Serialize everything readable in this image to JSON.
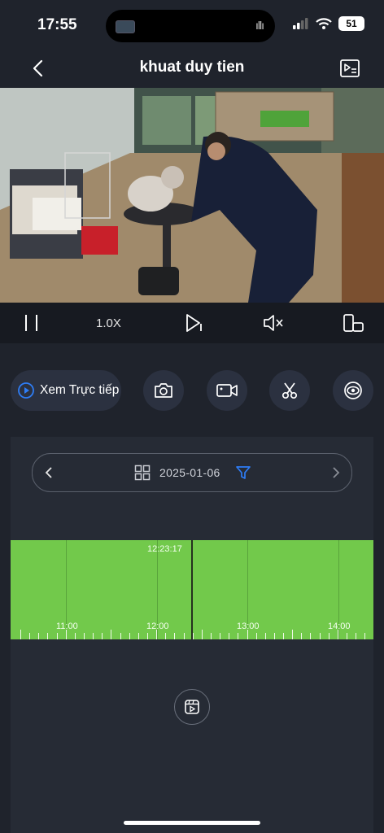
{
  "status": {
    "time": "17:55",
    "battery": "51"
  },
  "header": {
    "title": "khuat duy tien"
  },
  "player": {
    "speed": "1.0X"
  },
  "actions": {
    "live_label": "Xem Trực tiếp"
  },
  "playback": {
    "date": "2025-01-06",
    "cursor_time": "12:23:17",
    "hours": [
      "11:00",
      "12:00",
      "13:00",
      "14:00"
    ]
  },
  "colors": {
    "timeline": "#72c94b",
    "accent": "#2e7df6",
    "background": "#1f232c"
  },
  "icons": [
    "back-icon",
    "playlist-icon",
    "pause-icon",
    "play-icon",
    "mute-icon",
    "rotate-icon",
    "live-icon",
    "camera-icon",
    "record-video-icon",
    "scissors-icon",
    "eye-icon",
    "grid-icon",
    "filter-icon",
    "chevron-left-icon",
    "chevron-right-icon",
    "recordings-icon"
  ]
}
